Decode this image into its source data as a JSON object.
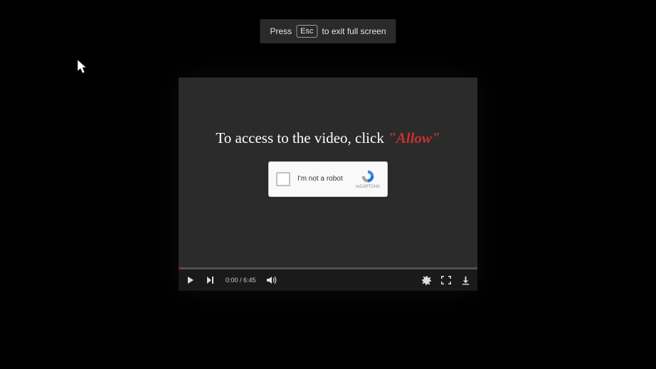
{
  "esc_banner": {
    "prefix": "Press",
    "key": "Esc",
    "suffix": "to exit full screen"
  },
  "overlay": {
    "prompt_text": "To access to the video, click ",
    "allow_text": "\"Allow\""
  },
  "captcha": {
    "label": "I'm not a robot",
    "brand": "reCAPTCHA"
  },
  "player": {
    "current_time": "0:00",
    "duration": "6:45",
    "time_display": "0:00 / 6:45"
  }
}
